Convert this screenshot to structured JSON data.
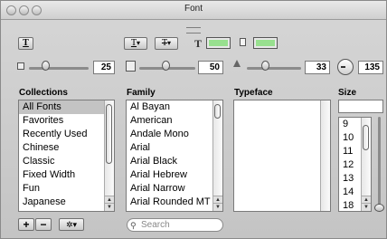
{
  "window": {
    "title": "Font"
  },
  "toolbar": {
    "text_style_glyph": "T",
    "underline_glyph": "T",
    "strike_glyph": "T",
    "text_color_glyph": "T",
    "doc_color_glyph": "D",
    "dropdown_glyph": "▾",
    "text_color": "#98e08f",
    "doc_color": "#98e08f"
  },
  "sliders": {
    "shadow_opacity_value": "25",
    "shadow_blur_value": "50",
    "shadow_offset_value": "33",
    "shadow_angle_value": "135"
  },
  "columns": {
    "collections_header": "Collections",
    "family_header": "Family",
    "typeface_header": "Typeface",
    "size_header": "Size"
  },
  "collections": [
    "All Fonts",
    "Favorites",
    "Recently Used",
    "Chinese",
    "Classic",
    "Fixed Width",
    "Fun",
    "Japanese"
  ],
  "families": [
    "Al Bayan",
    "American",
    "Andale Mono",
    "Arial",
    "Arial Black",
    "Arial Hebrew",
    "Arial Narrow",
    "Arial Rounded MT"
  ],
  "sizes": [
    "9",
    "10",
    "11",
    "12",
    "13",
    "14",
    "18"
  ],
  "size_input": "",
  "bottom": {
    "add_glyph": "+",
    "remove_glyph": "−",
    "action_glyph": "✲▾",
    "search_placeholder": "Search"
  }
}
